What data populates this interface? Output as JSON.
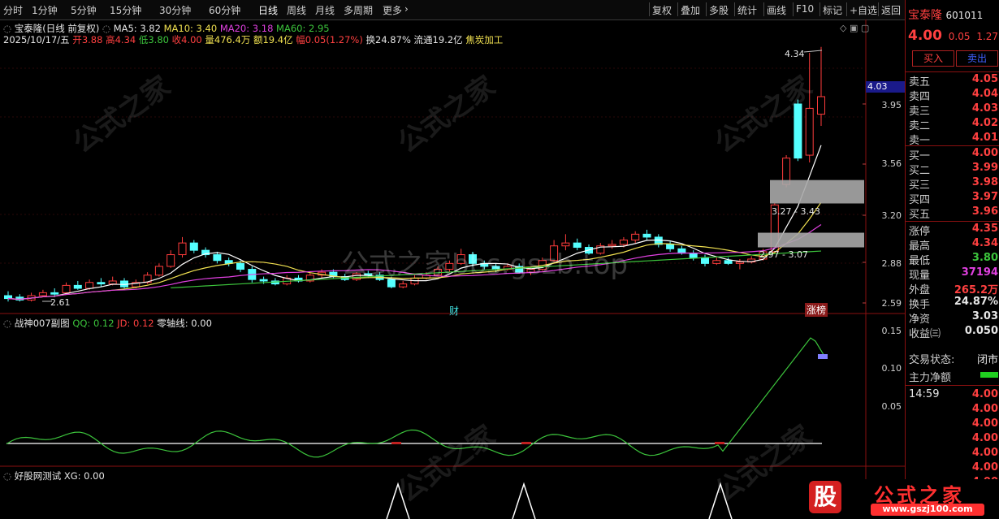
{
  "toolbar": {
    "periods": [
      "分时",
      "1分钟",
      "5分钟",
      "15分钟",
      "30分钟",
      "60分钟",
      "日线",
      "周线",
      "月线",
      "多周期",
      "更多"
    ],
    "active_period": "日线",
    "tools": [
      "复权",
      "叠加",
      "多股",
      "统计",
      "画线",
      "F10",
      "标记",
      "+自选",
      "返回"
    ]
  },
  "main_chart": {
    "title": "宝泰隆(日线 前复权)",
    "ma_labels": {
      "ma5": "MA5: 3.82",
      "ma10": "MA10: 3.40",
      "ma20": "MA20: 3.18",
      "ma60": "MA60: 2.95"
    },
    "info_date": "2025/10/17/五",
    "info_open": "开3.88",
    "info_high": "高4.34",
    "info_low": "低3.80",
    "info_close": "收4.00",
    "info_vol": "量476.4万",
    "info_amt": "额19.4亿",
    "info_range": "幅0.05(1.27%)",
    "info_turnover": "换24.87%",
    "info_float": "流通19.2亿",
    "info_sector": "焦炭加工",
    "price_axis": [
      "3.95",
      "3.56",
      "3.20",
      "2.88",
      "2.59"
    ],
    "current_price_tag": "4.03",
    "annotations": {
      "high": "4.34",
      "low": "2.61",
      "zone_upper": "3.27 - 3.43",
      "zone_lower": "2.97 - 3.07",
      "cai": "财",
      "zhangbang": "涨榜"
    },
    "watermark": "公式之家bbs.gszb.top"
  },
  "sub_chart": {
    "title": "战神007副图",
    "qq": "QQ: 0.12",
    "jd": "JD: 0.12",
    "zero": "零轴线: 0.00",
    "axis": [
      "0.15",
      "0.10",
      "0.05"
    ]
  },
  "bottom_chart": {
    "title": "好股网测试",
    "x": "XG: 0.00"
  },
  "right_panel": {
    "name": "宝泰隆",
    "code": "601011",
    "price": "4.00",
    "change": "0.05",
    "pct": "1.27",
    "buy_label": "买入",
    "sell_label": "卖出",
    "asks": [
      {
        "label": "卖五",
        "value": "4.05"
      },
      {
        "label": "卖四",
        "value": "4.04"
      },
      {
        "label": "卖三",
        "value": "4.03"
      },
      {
        "label": "卖二",
        "value": "4.02"
      },
      {
        "label": "卖一",
        "value": "4.01"
      }
    ],
    "bids": [
      {
        "label": "买一",
        "value": "4.00"
      },
      {
        "label": "买二",
        "value": "3.99"
      },
      {
        "label": "买三",
        "value": "3.98"
      },
      {
        "label": "买四",
        "value": "3.97"
      },
      {
        "label": "买五",
        "value": "3.96"
      }
    ],
    "stats": [
      {
        "label": "涨停",
        "value": "4.35",
        "color": "#ff4040"
      },
      {
        "label": "最高",
        "value": "4.34",
        "color": "#ff4040"
      },
      {
        "label": "最低",
        "value": "3.80",
        "color": "#3cc43c"
      },
      {
        "label": "现量",
        "value": "37194",
        "color": "#e040e0"
      },
      {
        "label": "外盘",
        "value": "265.2万",
        "color": "#ff4040"
      },
      {
        "label": "换手",
        "value": "24.87%",
        "color": "#e6e6e6"
      },
      {
        "label": "净资",
        "value": "3.03",
        "color": "#e6e6e6"
      },
      {
        "label": "收益㈢",
        "value": "0.050",
        "color": "#e6e6e6"
      }
    ],
    "trade_status_label": "交易状态:",
    "trade_status_value": "闭市",
    "main_flow_label": "主力净额",
    "ticks_time": "14:59",
    "ticks": [
      "4.00",
      "4.00",
      "4.00",
      "4.00",
      "4.00",
      "4.00",
      "4.00"
    ],
    "logo_text": "公式之家",
    "logo_url": "www.gszj100.com",
    "logo_char": "股"
  }
}
